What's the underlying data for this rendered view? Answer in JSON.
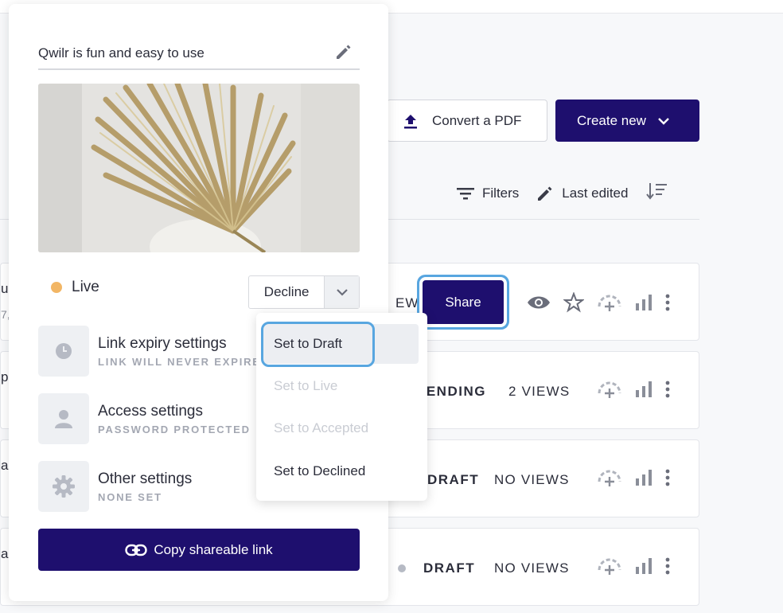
{
  "header": {
    "convert_pdf_label": "Convert a PDF",
    "create_new_label": "Create new"
  },
  "sort": {
    "filters_label": "Filters",
    "last_edited_label": "Last edited"
  },
  "rows": [
    {
      "peek": "u",
      "peek2": "7,",
      "status": "EW",
      "share_label": "Share"
    },
    {
      "peek": "p",
      "status": "PENDING",
      "views": "2 VIEWS"
    },
    {
      "peek": "a",
      "status": "DRAFT",
      "views": "NO VIEWS"
    },
    {
      "peek": "ar",
      "status": "DRAFT",
      "views": "NO VIEWS"
    }
  ],
  "popover": {
    "title": "Qwilr is fun and easy to use",
    "status_label": "Live",
    "status_color": "#f2b665",
    "decline_label": "Decline",
    "settings": [
      {
        "name": "Link expiry settings",
        "sub": "LINK WILL NEVER EXPIRE",
        "icon": "clock-icon"
      },
      {
        "name": "Access settings",
        "sub": "PASSWORD PROTECTED",
        "icon": "person-icon"
      },
      {
        "name": "Other settings",
        "sub": "NONE SET",
        "icon": "gear-icon"
      }
    ],
    "copy_link_label": "Copy shareable link"
  },
  "status_menu": {
    "options": [
      {
        "label": "Set to Draft",
        "state": "selected"
      },
      {
        "label": "Set to Live",
        "state": "disabled"
      },
      {
        "label": "Set to Accepted",
        "state": "disabled"
      },
      {
        "label": "Set to Declined",
        "state": "enabled"
      }
    ]
  },
  "colors": {
    "brand": "#1e0f6e",
    "focus": "#58a6e0",
    "live": "#f2b665"
  }
}
